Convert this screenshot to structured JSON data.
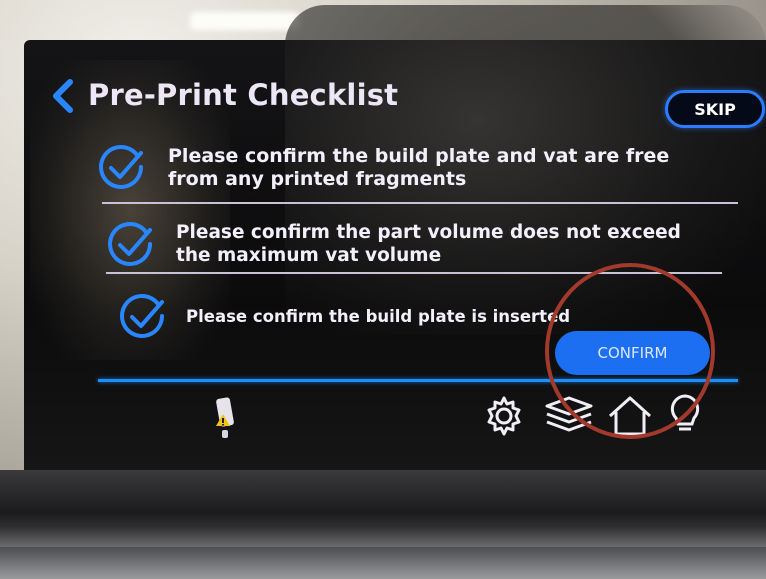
{
  "screen": {
    "title": "Pre-Print Checklist",
    "skip_label": "SKIP",
    "checklist": [
      {
        "lines": [
          "Please confirm the build plate and vat are free",
          "from any printed fragments"
        ]
      },
      {
        "lines": [
          "Please confirm the part volume does not exceed",
          "the maximum vat volume"
        ]
      },
      {
        "lines": [
          "Please confirm the build plate is inserted"
        ]
      }
    ],
    "confirm_label": "CONFIRM"
  },
  "footer": {
    "icons": [
      "resin-warning-icon",
      "gear-icon",
      "layers-icon",
      "home-icon",
      "lightbulb-icon"
    ]
  },
  "colors": {
    "accent": "#1d6ff2",
    "check_blue": "#2a86ff",
    "annotation": "#a23a2c"
  }
}
